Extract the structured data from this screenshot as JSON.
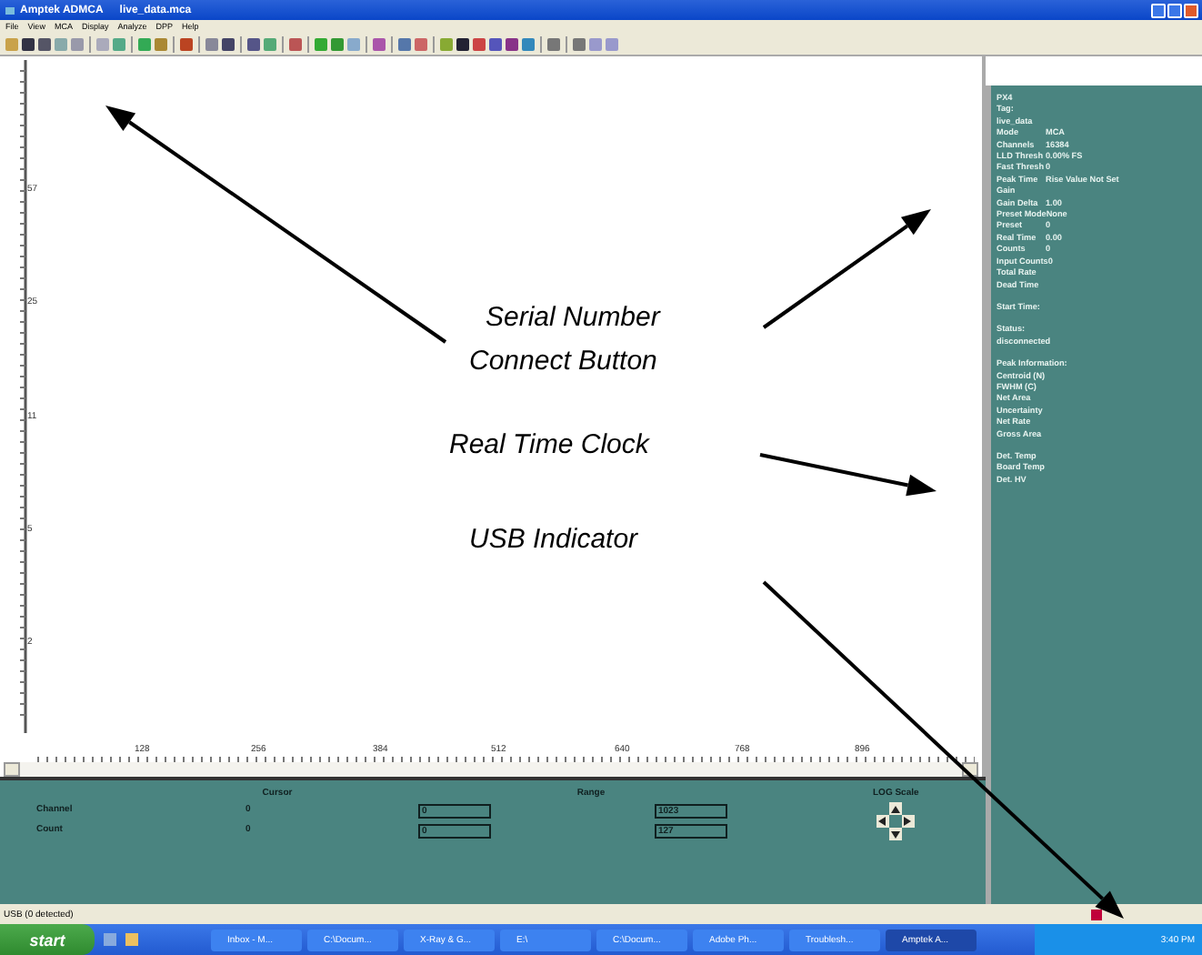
{
  "window": {
    "app": "Amptek ADMCA",
    "document": "live_data.mca"
  },
  "menu": [
    "File",
    "View",
    "MCA",
    "Display",
    "Analyze",
    "DPP",
    "Help"
  ],
  "plot": {
    "y_ticks": [
      "57",
      "25",
      "11",
      "5",
      "2"
    ],
    "x_ticks": [
      "128",
      "256",
      "384",
      "512",
      "640",
      "768",
      "896"
    ]
  },
  "info_sections": [
    {
      "rows": [
        {
          "label": "PX4"
        },
        {
          "label": "Tag:"
        },
        {
          "label": "live_data"
        },
        {
          "label": "Mode",
          "value": "MCA"
        },
        {
          "label": "Channels",
          "value": "16384"
        },
        {
          "label": "LLD Thresh",
          "value": "0.00% FS"
        },
        {
          "label": "Fast Thresh",
          "value": "0"
        },
        {
          "label": "Peak Time",
          "value": "Rise Value Not Set"
        },
        {
          "label": "Gain"
        },
        {
          "label": "Gain Delta",
          "value": "1.00"
        },
        {
          "label": "Preset Mode",
          "value": "None"
        },
        {
          "label": "Preset",
          "value": "0"
        },
        {
          "label": "Real Time",
          "value": "0.00"
        },
        {
          "label": "Counts",
          "value": "0"
        },
        {
          "label": "Input Counts",
          "value": "0"
        },
        {
          "label": "Total Rate"
        },
        {
          "label": "Dead Time"
        }
      ]
    },
    {
      "rows": [
        {
          "label": "Start Time:"
        }
      ]
    },
    {
      "rows": [
        {
          "label": "Status:"
        },
        {
          "label": "disconnected"
        }
      ]
    },
    {
      "rows": [
        {
          "label": "Peak Information:"
        },
        {
          "label": "Centroid (N)"
        },
        {
          "label": "FWHM (C)"
        },
        {
          "label": "Net Area"
        },
        {
          "label": "Uncertainty"
        },
        {
          "label": "Net Rate"
        },
        {
          "label": "Gross Area"
        }
      ]
    },
    {
      "rows": [
        {
          "label": "Det. Temp"
        },
        {
          "label": "Board Temp"
        },
        {
          "label": "Det. HV"
        }
      ]
    }
  ],
  "cursor_panel": {
    "cursor_header": "Cursor",
    "range_header": "Range",
    "log_header": "LOG Scale",
    "rows": [
      {
        "label": "Channel",
        "cursor": "0",
        "range_low": "0",
        "range_high": "1023"
      },
      {
        "label": "Count",
        "cursor": "0",
        "range_low": "0",
        "range_high": "127"
      }
    ]
  },
  "status_bar": {
    "text": "USB (0 detected)",
    "usb_connected": false
  },
  "taskbar": {
    "start": "start",
    "tasks": [
      {
        "label": "Inbox - M...",
        "selected": false
      },
      {
        "label": "C:\\Docum...",
        "selected": false
      },
      {
        "label": "X-Ray & G...",
        "selected": false
      },
      {
        "label": "E:\\",
        "selected": false
      },
      {
        "label": "C:\\Docum...",
        "selected": false
      },
      {
        "label": "Adobe Ph...",
        "selected": false
      },
      {
        "label": "Troublesh...",
        "selected": false
      },
      {
        "label": "Amptek A...",
        "selected": true
      }
    ],
    "clock": "3:40 PM"
  },
  "annotations": [
    {
      "text": "Serial Number"
    },
    {
      "text": "Connect Button"
    },
    {
      "text": "Real Time Clock"
    },
    {
      "text": "USB Indicator"
    }
  ]
}
